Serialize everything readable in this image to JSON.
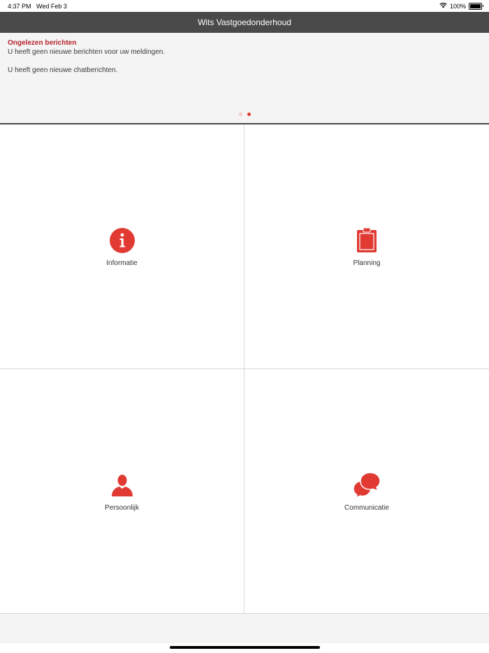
{
  "status_bar": {
    "time": "4:37 PM",
    "date": "Wed Feb 3",
    "battery": "100%",
    "wifi_icon": "wifi-icon",
    "battery_icon": "battery-icon"
  },
  "nav": {
    "title": "Wits Vastgoedonderhoud"
  },
  "messages": {
    "heading": "Ongelezen berichten",
    "line1": "U heeft geen nieuwe berichten voor uw meldingen.",
    "line2": "U heeft geen nieuwe chatberichten.",
    "page_count": 2,
    "active_page": 2
  },
  "tiles": [
    {
      "label": "Informatie",
      "icon": "info-icon"
    },
    {
      "label": "Planning",
      "icon": "clipboard-icon"
    },
    {
      "label": "Persoonlijk",
      "icon": "person-icon"
    },
    {
      "label": "Communicatie",
      "icon": "chat-bubbles-icon"
    }
  ],
  "colors": {
    "accent": "#e03a32",
    "heading_red": "#b5232a",
    "nav_bg": "#4a4a4a"
  }
}
